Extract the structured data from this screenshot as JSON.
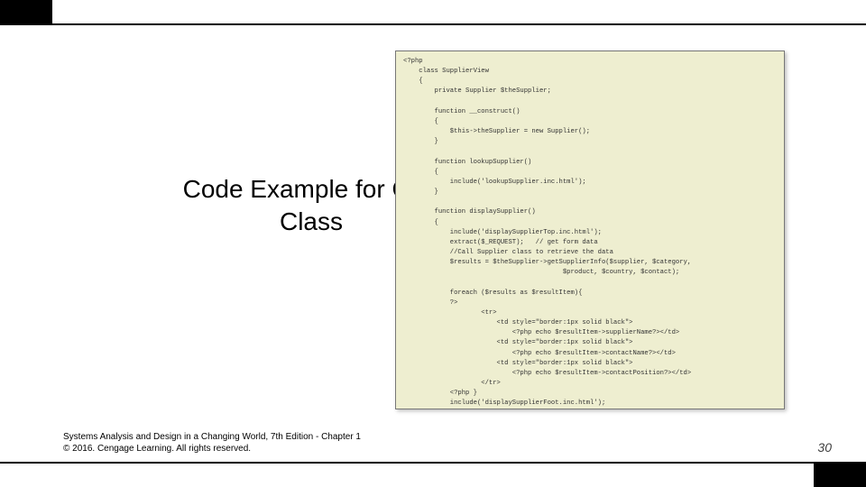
{
  "slide": {
    "title": "Code Example for One Class",
    "footer_line1": "Systems Analysis and Design in a Changing World, 7th Edition - Chapter 1",
    "footer_line2": "© 2016. Cengage Learning. All rights reserved.",
    "page_number": "30"
  },
  "code": "<?php\n    class SupplierView\n    {\n        private Supplier $theSupplier;\n\n        function __construct()\n        {\n            $this->theSupplier = new Supplier();\n        }\n\n        function lookupSupplier()\n        {\n            include('lookupSupplier.inc.html');\n        }\n\n        function displaySupplier()\n        {\n            include('displaySupplierTop.inc.html');\n            extract($_REQUEST);   // get form data\n            //Call Supplier class to retrieve the data\n            $results = $theSupplier->getSupplierInfo($supplier, $category,\n                                         $product, $country, $contact);\n\n            foreach ($results as $resultItem){\n            ?>\n                    <tr>\n                        <td style=\"border:1px solid black\">\n                            <?php echo $resultItem->supplierName?></td>\n                        <td style=\"border:1px solid black\">\n                            <?php echo $resultItem->contactName?></td>\n                        <td style=\"border:1px solid black\">\n                            <?php echo $resultItem->contactPosition?></td>\n                    </tr>\n            <?php }\n            include('displaySupplierFoot.inc.html');\n        }\n    }\n?>"
}
